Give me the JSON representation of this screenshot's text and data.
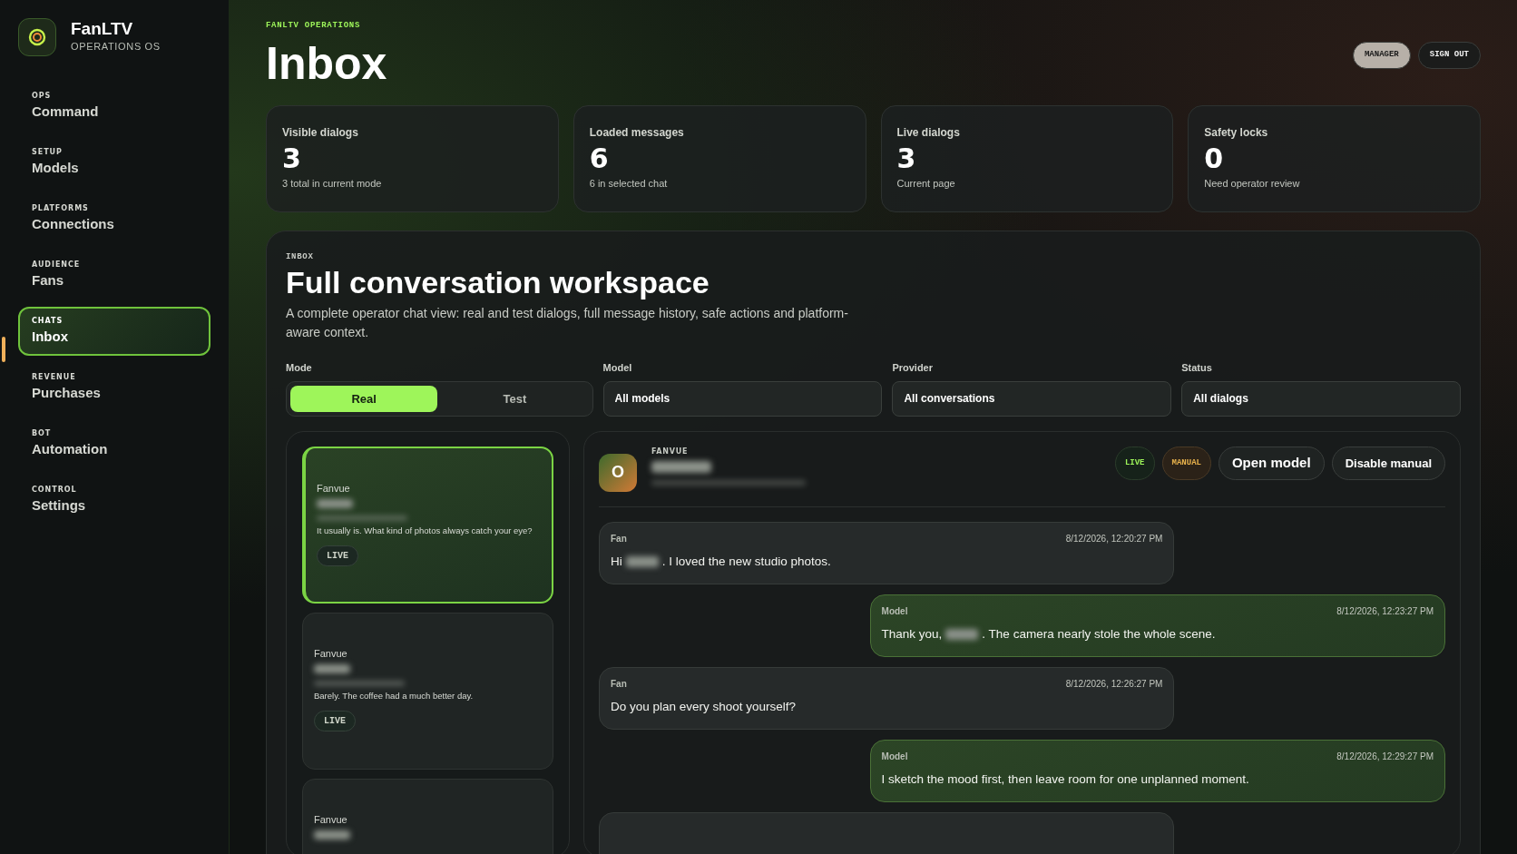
{
  "brand": {
    "name": "FanLTV",
    "subtitle": "OPERATIONS OS"
  },
  "nav": [
    {
      "kicker": "OPS",
      "label": "Command",
      "selected": false
    },
    {
      "kicker": "SETUP",
      "label": "Models",
      "selected": false
    },
    {
      "kicker": "PLATFORMS",
      "label": "Connections",
      "selected": false
    },
    {
      "kicker": "AUDIENCE",
      "label": "Fans",
      "selected": false
    },
    {
      "kicker": "CHATS",
      "label": "Inbox",
      "selected": true
    },
    {
      "kicker": "REVENUE",
      "label": "Purchases",
      "selected": false
    },
    {
      "kicker": "BOT",
      "label": "Automation",
      "selected": false
    },
    {
      "kicker": "CONTROL",
      "label": "Settings",
      "selected": false
    }
  ],
  "header": {
    "eyebrow": "FANLTV OPERATIONS",
    "title": "Inbox",
    "actions": [
      {
        "label": "MANAGER",
        "kind": "role"
      },
      {
        "label": "SIGN OUT",
        "kind": "outline"
      }
    ]
  },
  "stats": [
    {
      "label": "Visible dialogs",
      "value": "3",
      "note": "3 total in current mode"
    },
    {
      "label": "Loaded messages",
      "value": "6",
      "note": "6 in selected chat"
    },
    {
      "label": "Live dialogs",
      "value": "3",
      "note": "Current page"
    },
    {
      "label": "Safety locks",
      "value": "0",
      "note": "Need operator review"
    }
  ],
  "workspace": {
    "eyebrow": "INBOX",
    "title": "Full conversation workspace",
    "description": "A complete operator chat view: real and test dialogs, full message history, safe actions and platform-aware context.",
    "filters": [
      {
        "label": "Mode",
        "kind": "segmented",
        "options": [
          {
            "label": "Real",
            "selected": true
          },
          {
            "label": "Test",
            "selected": false
          }
        ]
      },
      {
        "label": "Model",
        "kind": "select",
        "value": "All models"
      },
      {
        "label": "Provider",
        "kind": "select",
        "value": "All conversations"
      },
      {
        "label": "Status",
        "kind": "select",
        "value": "All dialogs"
      }
    ]
  },
  "conversations": [
    {
      "provider": "Fanvue",
      "preview": "It usually is. What kind of photos always catch your eye?",
      "badge": "LIVE",
      "selected": true
    },
    {
      "provider": "Fanvue",
      "preview": "Barely. The coffee had a much better day.",
      "badge": "LIVE",
      "selected": false
    },
    {
      "provider": "Fanvue",
      "selected": false
    }
  ],
  "chat": {
    "provider": "FANVUE",
    "avatar": "O",
    "badges": [
      {
        "label": "LIVE",
        "kind": "live"
      },
      {
        "label": "MANUAL",
        "kind": "manual"
      }
    ],
    "buttons": [
      {
        "label": "Open model",
        "kind": "primary"
      },
      {
        "label": "Disable manual",
        "kind": "secondary"
      }
    ],
    "messages": [
      {
        "kind": "fan",
        "author": "Fan",
        "time": "8/12/2026, 12:20:27 PM",
        "text_before": "Hi",
        "text_after": ". I loved the new studio photos."
      },
      {
        "kind": "model",
        "author": "Model",
        "time": "8/12/2026, 12:23:27 PM",
        "text_before": "Thank you,",
        "text_after": ". The camera nearly stole the whole scene."
      },
      {
        "kind": "fan",
        "author": "Fan",
        "time": "8/12/2026, 12:26:27 PM",
        "text": "Do you plan every shoot yourself?"
      },
      {
        "kind": "model",
        "author": "Model",
        "time": "8/12/2026, 12:29:27 PM",
        "text": "I sketch the mood first, then leave room for one unplanned moment."
      },
      {
        "kind": "fan"
      }
    ]
  }
}
